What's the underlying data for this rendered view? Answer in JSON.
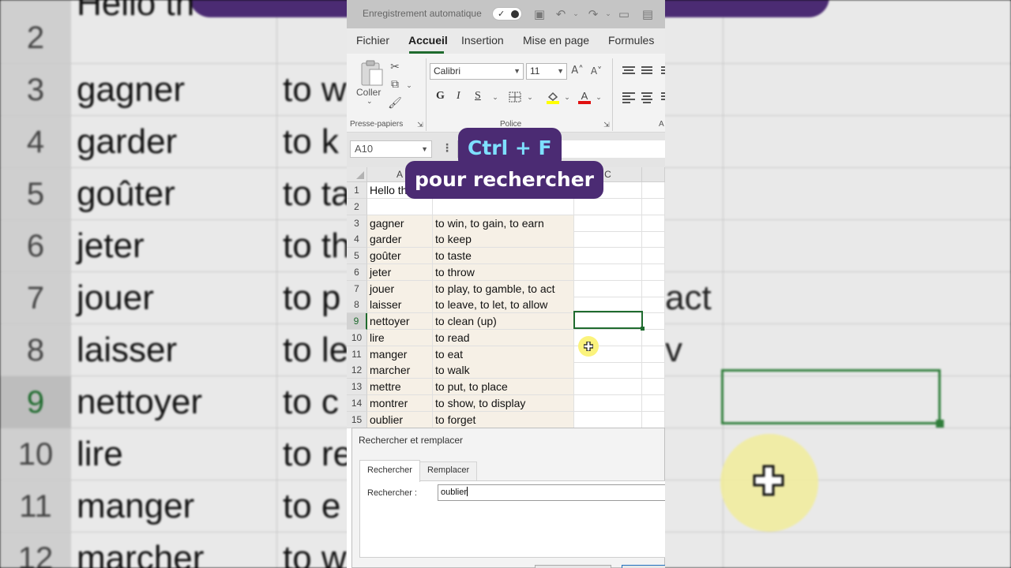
{
  "app": {
    "autosave_label": "Enregistrement automatique"
  },
  "ribbon_tabs": [
    "Fichier",
    "Accueil",
    "Insertion",
    "Mise en page",
    "Formules"
  ],
  "ribbon": {
    "paste_label": "Coller",
    "clipboard_group": "Presse-papiers",
    "font_group": "Police",
    "alignment_group_initial": "A",
    "font_name": "Calibri",
    "font_size": "11",
    "bold": "G",
    "italic": "I",
    "underline": "S"
  },
  "name_box": "A10",
  "overlay": {
    "line1": "Ctrl + F",
    "line2": "pour rechercher"
  },
  "columns": [
    "A",
    "C"
  ],
  "rows": [
    {
      "n": "1",
      "a": "Hello th",
      "b": ""
    },
    {
      "n": "2",
      "a": "",
      "b": ""
    },
    {
      "n": "3",
      "a": "gagner",
      "b": "to win, to gain, to earn"
    },
    {
      "n": "4",
      "a": "garder",
      "b": "to keep"
    },
    {
      "n": "5",
      "a": "goûter",
      "b": "to taste"
    },
    {
      "n": "6",
      "a": "jeter",
      "b": "to throw"
    },
    {
      "n": "7",
      "a": "jouer",
      "b": "to play, to gamble, to act"
    },
    {
      "n": "8",
      "a": "laisser",
      "b": "to leave, to let, to allow"
    },
    {
      "n": "9",
      "a": "nettoyer",
      "b": "to clean (up)"
    },
    {
      "n": "10",
      "a": "lire",
      "b": "to read"
    },
    {
      "n": "11",
      "a": "manger",
      "b": "to eat"
    },
    {
      "n": "12",
      "a": "marcher",
      "b": "to walk"
    },
    {
      "n": "13",
      "a": "mettre",
      "b": "to put, to place"
    },
    {
      "n": "14",
      "a": "montrer",
      "b": "to show, to display"
    },
    {
      "n": "15",
      "a": "oublier",
      "b": "to forget"
    }
  ],
  "background_zoom": {
    "rows": [
      {
        "n": "2",
        "a": "",
        "b": "",
        "right": ""
      },
      {
        "n": "3",
        "a": "gagner",
        "b": "to w",
        "right": ""
      },
      {
        "n": "4",
        "a": "garder",
        "b": "to k",
        "right": ""
      },
      {
        "n": "5",
        "a": "goûter",
        "b": "to ta",
        "right": ""
      },
      {
        "n": "6",
        "a": "jeter",
        "b": "to th",
        "right": ""
      },
      {
        "n": "7",
        "a": "jouer",
        "b": "to p",
        "right": "act"
      },
      {
        "n": "8",
        "a": "laisser",
        "b": "to le",
        "right": "v"
      },
      {
        "n": "9",
        "a": "nettoyer",
        "b": "to c",
        "right": ""
      },
      {
        "n": "10",
        "a": "lire",
        "b": "to re",
        "right": ""
      },
      {
        "n": "11",
        "a": "manger",
        "b": "to e",
        "right": ""
      },
      {
        "n": "12",
        "a": "marcher",
        "b": "to w",
        "right": ""
      }
    ],
    "top_partial": "Hello th"
  },
  "dialog": {
    "title": "Rechercher et remplacer",
    "tabs": [
      "Rechercher",
      "Remplacer"
    ],
    "find_label": "Rechercher :",
    "find_value": "oublier"
  },
  "colors": {
    "excel_green": "#1f6b2e",
    "caption_bg": "#4b2b73",
    "caption_accent": "#7ee0ff",
    "cell_shade": "#f6f0e6"
  }
}
